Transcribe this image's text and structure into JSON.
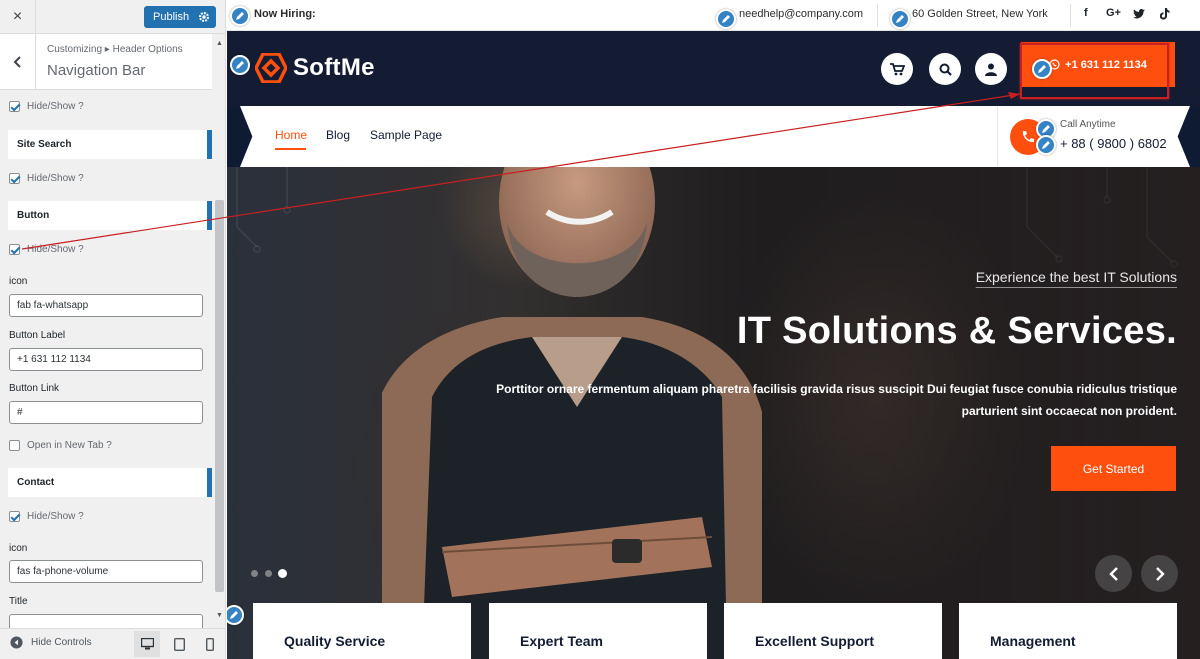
{
  "sidebar": {
    "close_label": "×",
    "publish_label": "Publish",
    "breadcrumb": "Customizing ▸ Header Options",
    "section_title": "Navigation Bar",
    "hide_show_1": "Hide/Show ?",
    "site_search_heading": "Site Search",
    "hide_show_2": "Hide/Show ?",
    "button_heading": "Button",
    "hide_show_3": "Hide/Show ?",
    "icon_label": "icon",
    "icon_value": "fab fa-whatsapp",
    "button_label_label": "Button Label",
    "button_label_value": "+1 631 112 1134",
    "button_link_label": "Button Link",
    "button_link_value": "#",
    "open_new_tab": "Open in New Tab ?",
    "contact_heading": "Contact",
    "hide_show_4": "Hide/Show ?",
    "contact_icon_label": "icon",
    "contact_icon_value": "fas fa-phone-volume",
    "title_label": "Title",
    "hide_controls": "Hide Controls"
  },
  "preview": {
    "topbar": {
      "now_hiring": "Now Hiring:",
      "email": "needhelp@company.com",
      "address": "60 Golden Street, New York",
      "social": [
        "f",
        "G+"
      ]
    },
    "logo_text": "SoftMe",
    "header_button": "+1 631 112 1134",
    "nav": [
      "Home",
      "Blog",
      "Sample Page"
    ],
    "call_label": "Call Anytime",
    "call_number": "+ 88 ( 9800 ) 6802",
    "hero": {
      "subtitle": "Experience the best IT Solutions",
      "title": "IT Solutions & Services.",
      "text": "Porttitor ornare fermentum aliquam pharetra facilisis gravida risus suscipit Dui feugiat fusce conubia ridiculus tristique parturient sint occaecat non proident.",
      "cta": "Get Started"
    },
    "features": [
      "Quality Service",
      "Expert Team",
      "Excellent Support",
      "Management"
    ]
  },
  "colors": {
    "accent": "#ff4f0f",
    "wp_blue": "#2271b1",
    "header_bg": "#131c33",
    "annotation_red": "#c82020"
  }
}
